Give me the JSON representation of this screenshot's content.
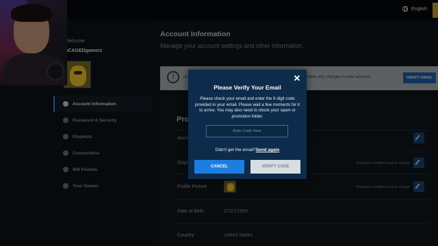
{
  "header": {
    "language": "English"
  },
  "sidebar": {
    "welcome": "Welcome",
    "username": "nCAGEDgamerz",
    "items": [
      {
        "label": "Account Information",
        "icon": "info-icon"
      },
      {
        "label": "Password & Security",
        "icon": "shield-icon"
      },
      {
        "label": "Playtests",
        "icon": "playtests-icon"
      },
      {
        "label": "Connections",
        "icon": "connections-icon"
      },
      {
        "label": "WB Friends",
        "icon": "add-friend-icon"
      },
      {
        "label": "Your Games",
        "icon": "gamepad-icon"
      }
    ]
  },
  "main": {
    "title": "Account Information",
    "subtitle": "Manage your account settings and other information.",
    "banner": {
      "text_left": "Pl",
      "text": "make any changes to your account.",
      "button": "VERIFY EMAIL"
    },
    "section_title": "Pro",
    "rows": [
      {
        "label": "Accou",
        "value": "",
        "note": ""
      },
      {
        "label": "Displ",
        "value": "",
        "note": "Requires a verified email to change"
      },
      {
        "label": "Profile Picture",
        "value": "",
        "note": "Requires a verified email to change"
      },
      {
        "label": "Date of Birth",
        "value": "07/27/1995",
        "note": ""
      },
      {
        "label": "Country",
        "value": "United States",
        "note": ""
      }
    ]
  },
  "modal": {
    "title": "Please Verify Your Email",
    "body": "Please check your email and enter the 6 digit code provided in your email. Please wait a few moments for it to arrive. You may also need to check your spam or promotion folder.",
    "code_placeholder": "Enter Code Here",
    "resend_prompt": "Didn't get the email?",
    "resend_link": "Send again",
    "cancel": "CANCEL",
    "verify": "VERIFY CODE"
  },
  "colors": {
    "accent": "#1c7fe0",
    "modal_bg": "#0d2c4b",
    "banner_bg": "#a9afb4"
  }
}
